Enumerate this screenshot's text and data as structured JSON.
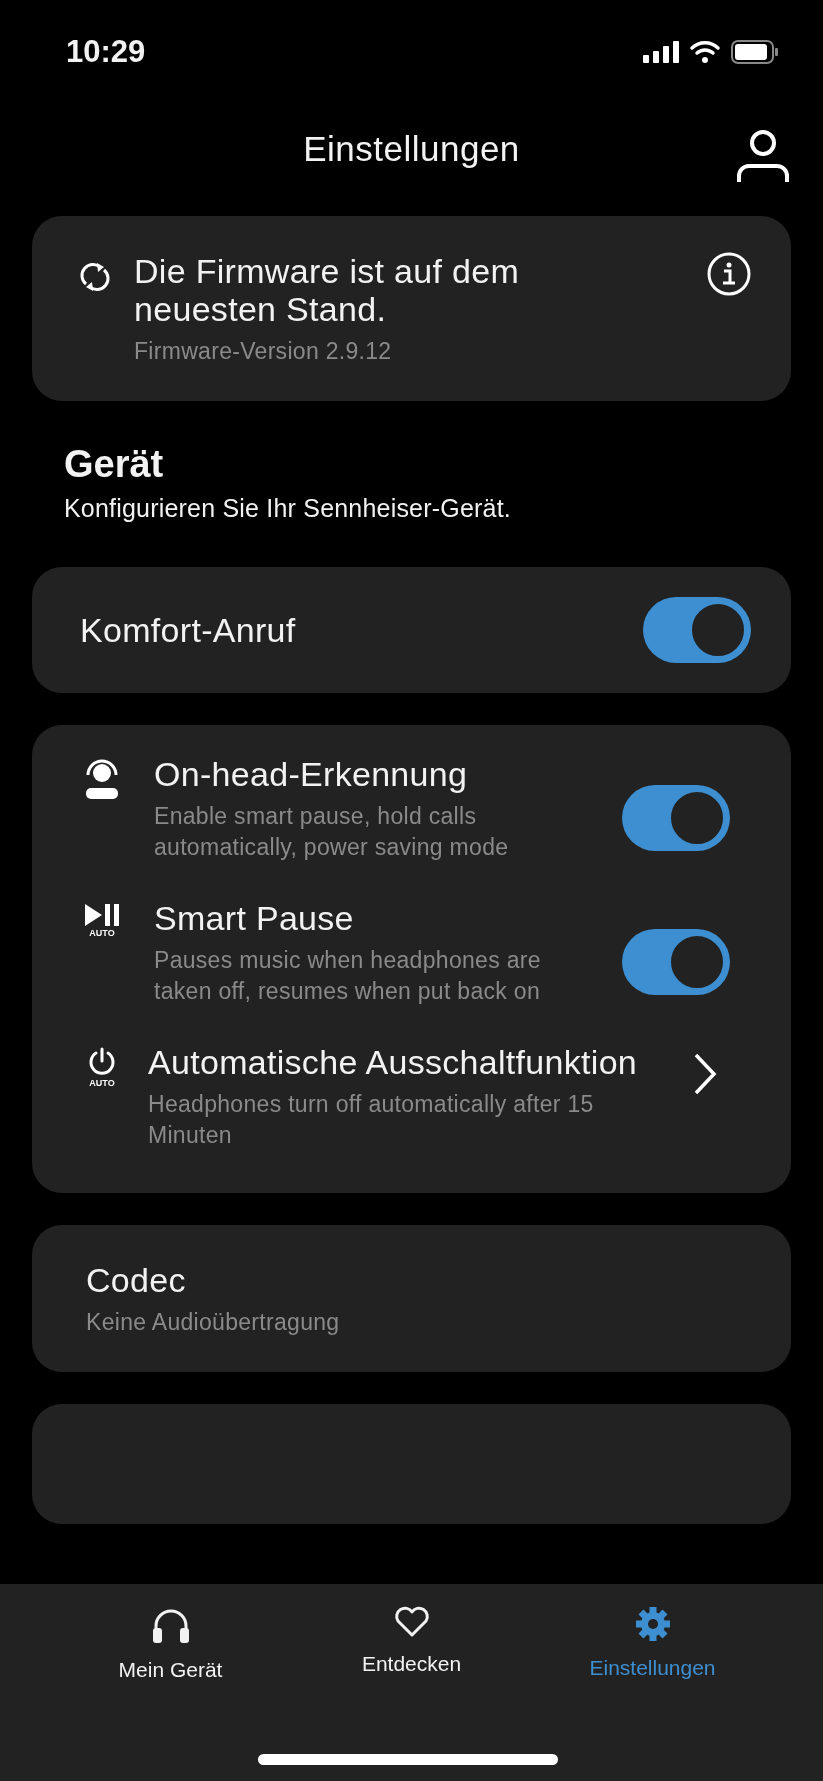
{
  "status_bar": {
    "time": "10:29"
  },
  "header": {
    "title": "Einstellungen"
  },
  "firmware": {
    "title": "Die Firmware ist auf dem neuesten Stand.",
    "version": "Firmware-Version 2.9.12"
  },
  "section": {
    "title": "Gerät",
    "subtitle": "Konfigurieren Sie Ihr Sennheiser-Gerät."
  },
  "comfort_call": {
    "label": "Komfort-Anruf",
    "on": true
  },
  "device_settings": [
    {
      "kind": "toggle",
      "title": "On-head-Erkennung",
      "description": "Enable smart pause, hold calls automatically, power saving mode",
      "on": true
    },
    {
      "kind": "toggle",
      "icon_caption": "AUTO",
      "title": "Smart Pause",
      "description": "Pauses music when headphones are taken off, resumes when put back on",
      "on": true
    },
    {
      "kind": "link",
      "icon_caption": "AUTO",
      "title": "Automatische Ausschaltfunktion",
      "description": "Headphones turn off automatically after 15 Minuten"
    }
  ],
  "codec": {
    "title": "Codec",
    "value": "Keine Audioübertragung"
  },
  "tab_bar": [
    {
      "label": "Mein Gerät",
      "selected": false
    },
    {
      "label": "Entdecken",
      "selected": false
    },
    {
      "label": "Einstellungen",
      "selected": true
    }
  ]
}
